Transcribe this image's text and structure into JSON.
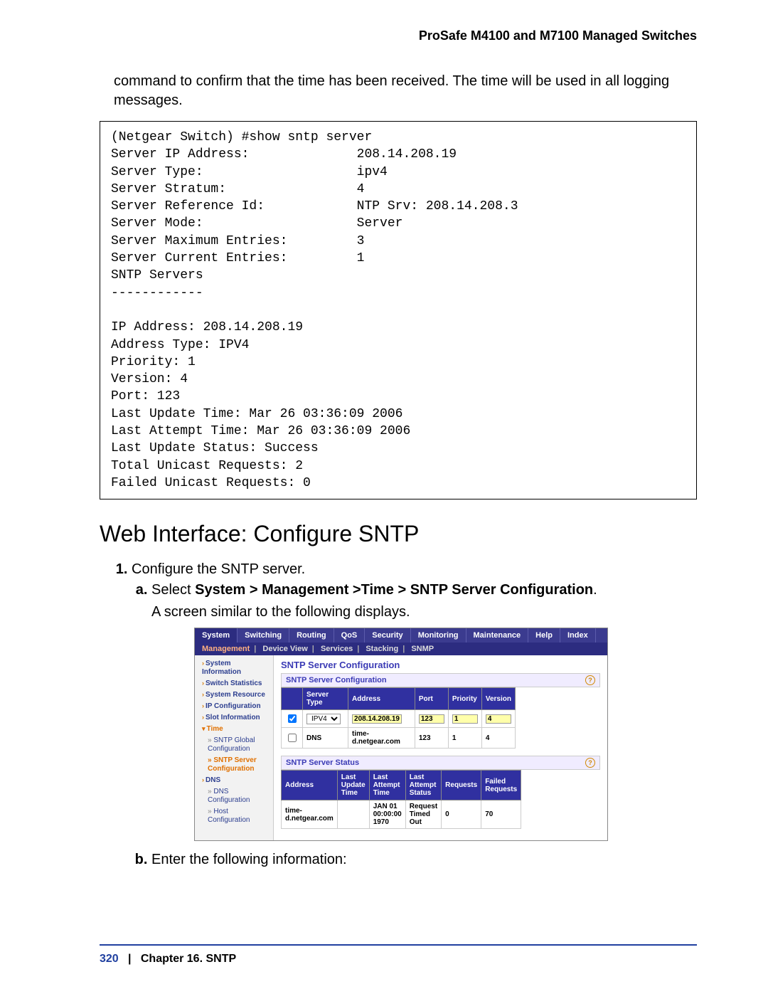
{
  "running_title": "ProSafe M4100 and M7100 Managed Switches",
  "intro_text": "command to confirm that the time has been received. The time will be used in all logging messages.",
  "code_block": "(Netgear Switch) #show sntp server\nServer IP Address:              208.14.208.19\nServer Type:                    ipv4\nServer Stratum:                 4\nServer Reference Id:            NTP Srv: 208.14.208.3\nServer Mode:                    Server\nServer Maximum Entries:         3\nServer Current Entries:         1\nSNTP Servers\n------------\n\nIP Address: 208.14.208.19\nAddress Type: IPV4\nPriority: 1\nVersion: 4\nPort: 123\nLast Update Time: Mar 26 03:36:09 2006\nLast Attempt Time: Mar 26 03:36:09 2006\nLast Update Status: Success\nTotal Unicast Requests: 2\nFailed Unicast Requests: 0",
  "h2": "Web Interface: Configure SNTP",
  "step1": "Configure the SNTP server.",
  "step_a_prefix": "Select ",
  "step_a_bold": "System > Management >Time > SNTP Server Configuration",
  "step_a_suffix": ".",
  "step_a_after": "A screen similar to the following displays.",
  "step_b": "Enter the following information:",
  "ui": {
    "main_tabs": [
      "System",
      "Switching",
      "Routing",
      "QoS",
      "Security",
      "Monitoring",
      "Maintenance",
      "Help",
      "Index"
    ],
    "active_main_tab": "System",
    "sub_tabs": [
      "Management",
      "Device View",
      "Services",
      "Stacking",
      "SNMP"
    ],
    "active_sub_tab": "Management",
    "sidebar": [
      {
        "label": "System Information",
        "caret": true,
        "bold": true
      },
      {
        "label": "Switch Statistics",
        "caret": true,
        "bold": true
      },
      {
        "label": "System Resource",
        "caret": true,
        "bold": true
      },
      {
        "label": "IP Configuration",
        "caret": true,
        "bold": true
      },
      {
        "label": "Slot Information",
        "caret": true,
        "bold": true
      },
      {
        "label": "Time",
        "caret": true,
        "active": true
      },
      {
        "label": "SNTP Global Configuration",
        "indent": true
      },
      {
        "label": "SNTP Server Configuration",
        "indent": true,
        "active": true
      },
      {
        "label": "DNS",
        "caret": true,
        "bold": true
      },
      {
        "label": "DNS Configuration",
        "indent": true
      },
      {
        "label": "Host Configuration",
        "indent": true
      }
    ],
    "pane_title": "SNTP Server Configuration",
    "section1_title": "SNTP Server Configuration",
    "cfg_headers": [
      "",
      "Server Type",
      "Address",
      "Port",
      "Priority",
      "Version"
    ],
    "cfg_rows": [
      {
        "chk": true,
        "type": "IPV4",
        "addr": "208.14.208.19",
        "port": "123",
        "pri": "1",
        "ver": "4",
        "highlight": true
      },
      {
        "chk": false,
        "type": "DNS",
        "addr": "time-d.netgear.com",
        "port": "123",
        "pri": "1",
        "ver": "4",
        "highlight": false
      }
    ],
    "section2_title": "SNTP Server Status",
    "status_headers": [
      "Address",
      "Last Update Time",
      "Last Attempt Time",
      "Last Attempt Status",
      "Requests",
      "Failed Requests"
    ],
    "status_row": {
      "addr": "time-d.netgear.com",
      "lut": "",
      "lat": "JAN 01 00:00:00 1970",
      "las": "Request Timed Out",
      "req": "0",
      "freq": "70"
    }
  },
  "footer": {
    "page": "320",
    "sep": "|",
    "chapter": "Chapter 16.  SNTP"
  }
}
